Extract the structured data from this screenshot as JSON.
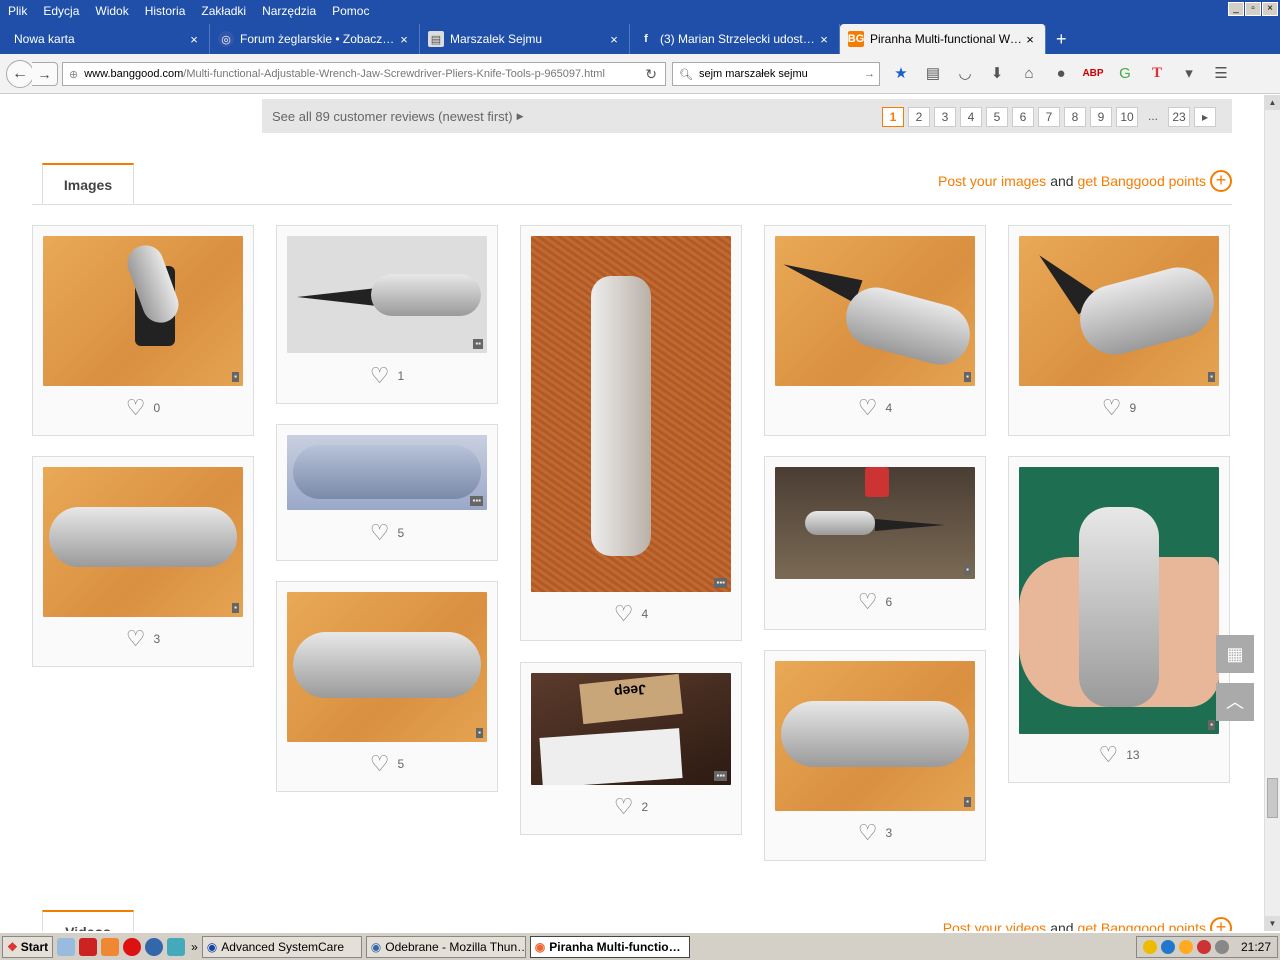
{
  "menu": [
    "Plik",
    "Edycja",
    "Widok",
    "Historia",
    "Zakładki",
    "Narzędzia",
    "Pomoc"
  ],
  "tabs": [
    {
      "label": "Nowa karta",
      "icon": "blank-page-icon"
    },
    {
      "label": "Forum żeglarskie • Zobacz wą…",
      "icon": "forum-icon"
    },
    {
      "label": "Marszalek Sejmu",
      "icon": "document-icon"
    },
    {
      "label": "(3) Marian Strzelecki udostęp…",
      "icon": "facebook-icon"
    },
    {
      "label": "Piranha Multi-functional Wren…",
      "icon": "banggood-icon",
      "active": true
    }
  ],
  "url": {
    "host": "www.banggood.com",
    "path": "/Multi-functional-Adjustable-Wrench-Jaw-Screwdriver-Pliers-Knife-Tools-p-965097.html"
  },
  "search": {
    "value": "sejm marszałek sejmu"
  },
  "reviews": {
    "link": "See all 89 customer reviews (newest first)",
    "pages": [
      "1",
      "2",
      "3",
      "4",
      "5",
      "6",
      "7",
      "8",
      "9",
      "10",
      "...",
      "23"
    ],
    "current": "1"
  },
  "images_section": {
    "tab": "Images",
    "post_a": "Post your images",
    "and": "and",
    "post_b": "get Banggood points"
  },
  "videos_section": {
    "tab": "Videos",
    "post_a": "Post your videos",
    "and": "and",
    "post_b": "get Banggood points"
  },
  "cards": [
    {
      "likes": "0"
    },
    {
      "likes": "1"
    },
    {
      "likes": "4"
    },
    {
      "likes": "4"
    },
    {
      "likes": "9"
    },
    {
      "likes": "3"
    },
    {
      "likes": "5"
    },
    {
      "likes": "6"
    },
    {
      "likes": "13"
    },
    {
      "likes": "5"
    },
    {
      "likes": "2"
    },
    {
      "likes": "3"
    }
  ],
  "jeep_label": "Jeep",
  "taskbar": {
    "start": "Start",
    "tasks": [
      "Advanced SystemCare",
      "Odebrane - Mozilla Thun…",
      "Piranha Multi-functio…"
    ],
    "clock": "21:27"
  }
}
